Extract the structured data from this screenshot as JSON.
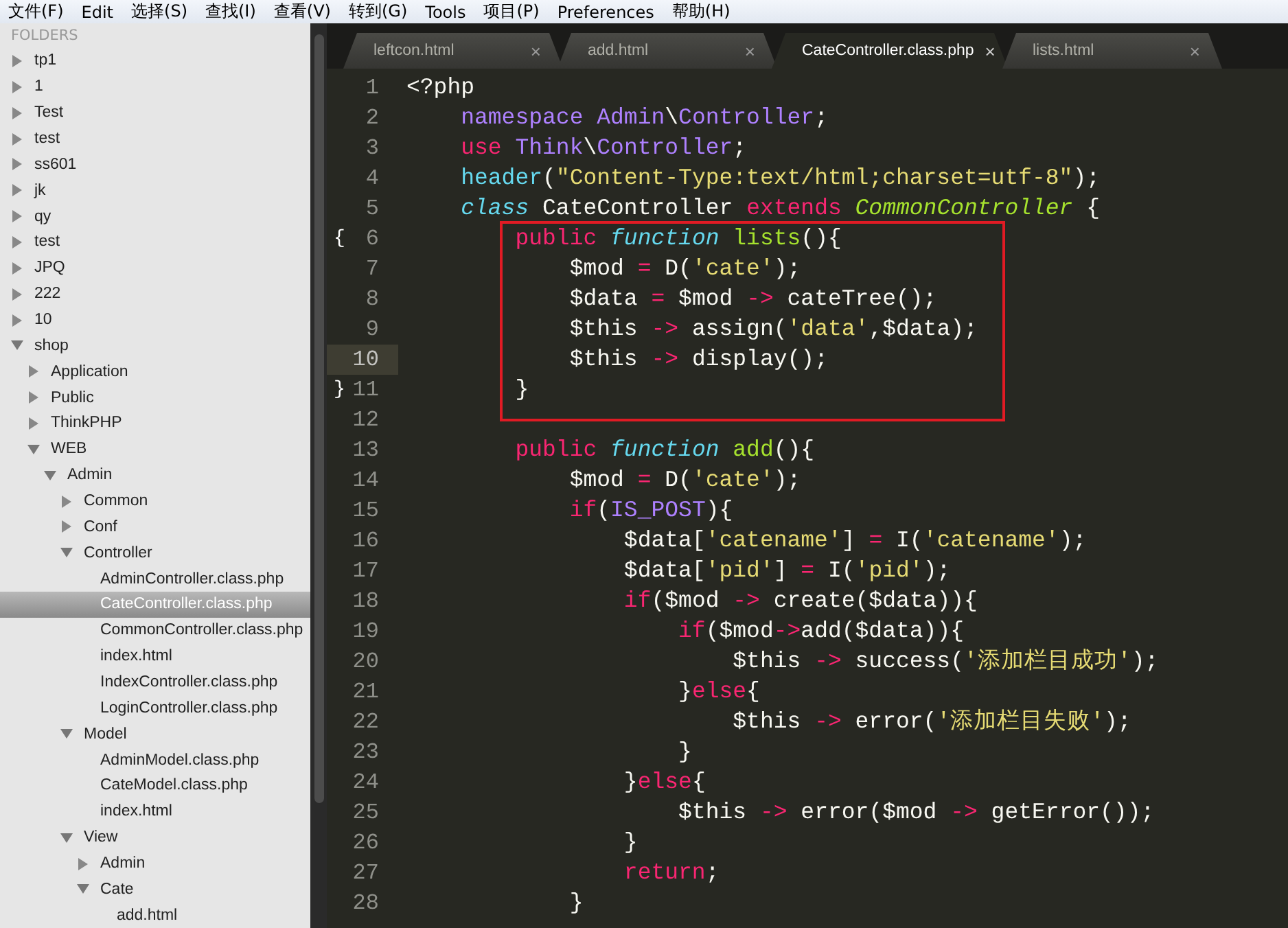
{
  "menu": [
    "文件(F)",
    "Edit",
    "选择(S)",
    "查找(I)",
    "查看(V)",
    "转到(G)",
    "Tools",
    "项目(P)",
    "Preferences",
    "帮助(H)"
  ],
  "sidebar": {
    "title": "FOLDERS",
    "items": [
      {
        "label": "tp1",
        "kind": "folder",
        "expanded": false,
        "selected": false
      },
      {
        "label": "1",
        "kind": "folder",
        "expanded": false,
        "selected": false
      },
      {
        "label": "Test",
        "kind": "folder",
        "expanded": false,
        "selected": false
      },
      {
        "label": "test",
        "kind": "folder",
        "expanded": false,
        "selected": false
      },
      {
        "label": "ss601",
        "kind": "folder",
        "expanded": false,
        "selected": false
      },
      {
        "label": "jk",
        "kind": "folder",
        "expanded": false,
        "selected": false
      },
      {
        "label": "qy",
        "kind": "folder",
        "expanded": false,
        "selected": false
      },
      {
        "label": "test",
        "kind": "folder",
        "expanded": false,
        "selected": false
      },
      {
        "label": "JPQ",
        "kind": "folder",
        "expanded": false,
        "selected": false
      },
      {
        "label": "222",
        "kind": "folder",
        "expanded": false,
        "selected": false
      },
      {
        "label": "10",
        "kind": "folder",
        "expanded": false,
        "selected": false
      },
      {
        "label": "shop",
        "kind": "folder",
        "expanded": true,
        "selected": false,
        "children": [
          {
            "label": "Application",
            "kind": "folder",
            "expanded": false,
            "selected": false
          },
          {
            "label": "Public",
            "kind": "folder",
            "expanded": false,
            "selected": false
          },
          {
            "label": "ThinkPHP",
            "kind": "folder",
            "expanded": false,
            "selected": false
          },
          {
            "label": "WEB",
            "kind": "folder",
            "expanded": true,
            "selected": false,
            "children": [
              {
                "label": "Admin",
                "kind": "folder",
                "expanded": true,
                "selected": false,
                "children": [
                  {
                    "label": "Common",
                    "kind": "folder",
                    "expanded": false,
                    "selected": false
                  },
                  {
                    "label": "Conf",
                    "kind": "folder",
                    "expanded": false,
                    "selected": false
                  },
                  {
                    "label": "Controller",
                    "kind": "folder",
                    "expanded": true,
                    "selected": false,
                    "children": [
                      {
                        "label": "AdminController.class.php",
                        "kind": "file",
                        "selected": false
                      },
                      {
                        "label": "CateController.class.php",
                        "kind": "file",
                        "selected": true
                      },
                      {
                        "label": "CommonController.class.php",
                        "kind": "file",
                        "selected": false
                      },
                      {
                        "label": "index.html",
                        "kind": "file",
                        "selected": false
                      },
                      {
                        "label": "IndexController.class.php",
                        "kind": "file",
                        "selected": false
                      },
                      {
                        "label": "LoginController.class.php",
                        "kind": "file",
                        "selected": false
                      }
                    ]
                  },
                  {
                    "label": "Model",
                    "kind": "folder",
                    "expanded": true,
                    "selected": false,
                    "children": [
                      {
                        "label": "AdminModel.class.php",
                        "kind": "file",
                        "selected": false
                      },
                      {
                        "label": "CateModel.class.php",
                        "kind": "file",
                        "selected": false
                      },
                      {
                        "label": "index.html",
                        "kind": "file",
                        "selected": false
                      }
                    ]
                  },
                  {
                    "label": "View",
                    "kind": "folder",
                    "expanded": true,
                    "selected": false,
                    "children": [
                      {
                        "label": "Admin",
                        "kind": "folder",
                        "expanded": false,
                        "selected": false
                      },
                      {
                        "label": "Cate",
                        "kind": "folder",
                        "expanded": true,
                        "selected": false,
                        "children": [
                          {
                            "label": "add.html",
                            "kind": "file",
                            "selected": false
                          }
                        ]
                      }
                    ]
                  }
                ]
              }
            ]
          }
        ]
      }
    ]
  },
  "tabs": [
    {
      "label": "leftcon.html",
      "close": "×",
      "selected": false
    },
    {
      "label": "add.html",
      "close": "×",
      "selected": false
    },
    {
      "label": "CateController.class.php",
      "close": "×",
      "selected": true
    },
    {
      "label": "lists.html",
      "close": "×",
      "selected": false
    }
  ],
  "code": [
    {
      "boxed": false,
      "lines": [
        {
          "number": "1",
          "current": false,
          "tokens": [
            {
              "kind": "text",
              "text": "<?php"
            }
          ]
        },
        {
          "number": "2",
          "current": false,
          "tokens": [
            {
              "kind": "constant",
              "text": "    namespace Admin"
            },
            {
              "kind": "text",
              "text": "\\"
            },
            {
              "kind": "constant",
              "text": "Controller"
            },
            {
              "kind": "text",
              "text": ";"
            }
          ]
        },
        {
          "number": "3",
          "current": false,
          "tokens": [
            {
              "kind": "keyword",
              "text": "    use "
            },
            {
              "kind": "constant",
              "text": "Think"
            },
            {
              "kind": "text",
              "text": "\\"
            },
            {
              "kind": "constant",
              "text": "Controller"
            },
            {
              "kind": "text",
              "text": ";"
            }
          ]
        },
        {
          "number": "4",
          "current": false,
          "tokens": [
            {
              "kind": "support",
              "text": "    header"
            },
            {
              "kind": "text",
              "text": "("
            },
            {
              "kind": "string",
              "text": "\"Content-Type:text/html;charset=utf-8\""
            },
            {
              "kind": "text",
              "text": ");"
            }
          ]
        },
        {
          "number": "5",
          "current": false,
          "tokens": [
            {
              "kind": "storage",
              "text": "    class"
            },
            {
              "kind": "text",
              "text": " CateController "
            },
            {
              "kind": "keyword",
              "text": "extends "
            },
            {
              "kind": "inherit",
              "text": "CommonController"
            },
            {
              "kind": "text",
              "text": " {"
            }
          ]
        }
      ]
    },
    {
      "boxed": true,
      "lines": [
        {
          "number": "6",
          "fold": "{",
          "current": false,
          "tokens": [
            {
              "kind": "keyword",
              "text": "        public "
            },
            {
              "kind": "storage",
              "text": "function "
            },
            {
              "kind": "entity",
              "text": "lists"
            },
            {
              "kind": "text",
              "text": "(){"
            }
          ]
        },
        {
          "number": "7",
          "current": false,
          "tokens": [
            {
              "kind": "text",
              "text": "            $mod "
            },
            {
              "kind": "operator",
              "text": "="
            },
            {
              "kind": "text",
              "text": " D("
            },
            {
              "kind": "string",
              "text": "'cate'"
            },
            {
              "kind": "text",
              "text": ");"
            }
          ]
        },
        {
          "number": "8",
          "current": false,
          "tokens": [
            {
              "kind": "text",
              "text": "            $data "
            },
            {
              "kind": "operator",
              "text": "="
            },
            {
              "kind": "text",
              "text": " $mod "
            },
            {
              "kind": "operator",
              "text": "->"
            },
            {
              "kind": "text",
              "text": " cateTree();"
            }
          ]
        },
        {
          "number": "9",
          "current": false,
          "tokens": [
            {
              "kind": "text",
              "text": "            $this "
            },
            {
              "kind": "operator",
              "text": "->"
            },
            {
              "kind": "text",
              "text": " assign("
            },
            {
              "kind": "string",
              "text": "'data'"
            },
            {
              "kind": "text",
              "text": ",$data);"
            }
          ]
        },
        {
          "number": "10",
          "current": true,
          "tokens": [
            {
              "kind": "text",
              "text": "            $this "
            },
            {
              "kind": "operator",
              "text": "->"
            },
            {
              "kind": "text",
              "text": " display();"
            }
          ]
        },
        {
          "number": "11",
          "fold": "}",
          "current": false,
          "tokens": [
            {
              "kind": "text",
              "text": "        }"
            }
          ]
        }
      ]
    },
    {
      "boxed": false,
      "lines": [
        {
          "number": "12",
          "current": false
        },
        {
          "number": "13",
          "current": false,
          "tokens": [
            {
              "kind": "keyword",
              "text": "        public "
            },
            {
              "kind": "storage",
              "text": "function "
            },
            {
              "kind": "entity",
              "text": "add"
            },
            {
              "kind": "text",
              "text": "(){"
            }
          ]
        },
        {
          "number": "14",
          "current": false,
          "tokens": [
            {
              "kind": "text",
              "text": "            $mod "
            },
            {
              "kind": "operator",
              "text": "="
            },
            {
              "kind": "text",
              "text": " D("
            },
            {
              "kind": "string",
              "text": "'cate'"
            },
            {
              "kind": "text",
              "text": ");"
            }
          ]
        },
        {
          "number": "15",
          "current": false,
          "tokens": [
            {
              "kind": "keyword",
              "text": "            if"
            },
            {
              "kind": "text",
              "text": "("
            },
            {
              "kind": "constant",
              "text": "IS_POST"
            },
            {
              "kind": "text",
              "text": "){"
            }
          ]
        },
        {
          "number": "16",
          "current": false,
          "tokens": [
            {
              "kind": "text",
              "text": "                $data["
            },
            {
              "kind": "string",
              "text": "'catename'"
            },
            {
              "kind": "text",
              "text": "] "
            },
            {
              "kind": "operator",
              "text": "="
            },
            {
              "kind": "text",
              "text": " I("
            },
            {
              "kind": "string",
              "text": "'catename'"
            },
            {
              "kind": "text",
              "text": ");"
            }
          ]
        },
        {
          "number": "17",
          "current": false,
          "tokens": [
            {
              "kind": "text",
              "text": "                $data["
            },
            {
              "kind": "string",
              "text": "'pid'"
            },
            {
              "kind": "text",
              "text": "] "
            },
            {
              "kind": "operator",
              "text": "="
            },
            {
              "kind": "text",
              "text": " I("
            },
            {
              "kind": "string",
              "text": "'pid'"
            },
            {
              "kind": "text",
              "text": ");"
            }
          ]
        },
        {
          "number": "18",
          "current": false,
          "tokens": [
            {
              "kind": "keyword",
              "text": "                if"
            },
            {
              "kind": "text",
              "text": "($mod "
            },
            {
              "kind": "operator",
              "text": "->"
            },
            {
              "kind": "text",
              "text": " create($data)){"
            }
          ]
        },
        {
          "number": "19",
          "current": false,
          "tokens": [
            {
              "kind": "keyword",
              "text": "                    if"
            },
            {
              "kind": "text",
              "text": "($mod"
            },
            {
              "kind": "operator",
              "text": "->"
            },
            {
              "kind": "text",
              "text": "add($data)){"
            }
          ]
        },
        {
          "number": "20",
          "current": false,
          "tokens": [
            {
              "kind": "text",
              "text": "                        $this "
            },
            {
              "kind": "operator",
              "text": "->"
            },
            {
              "kind": "text",
              "text": " success("
            },
            {
              "kind": "string",
              "text": "'添加栏目成功'"
            },
            {
              "kind": "text",
              "text": ");"
            }
          ]
        },
        {
          "number": "21",
          "current": false,
          "tokens": [
            {
              "kind": "text",
              "text": "                    }"
            },
            {
              "kind": "keyword",
              "text": "else"
            },
            {
              "kind": "text",
              "text": "{"
            }
          ]
        },
        {
          "number": "22",
          "current": false,
          "tokens": [
            {
              "kind": "text",
              "text": "                        $this "
            },
            {
              "kind": "operator",
              "text": "->"
            },
            {
              "kind": "text",
              "text": " error("
            },
            {
              "kind": "string",
              "text": "'添加栏目失败'"
            },
            {
              "kind": "text",
              "text": ");"
            }
          ]
        },
        {
          "number": "23",
          "current": false,
          "tokens": [
            {
              "kind": "text",
              "text": "                    }"
            }
          ]
        },
        {
          "number": "24",
          "current": false,
          "tokens": [
            {
              "kind": "text",
              "text": "                }"
            },
            {
              "kind": "keyword",
              "text": "else"
            },
            {
              "kind": "text",
              "text": "{"
            }
          ]
        },
        {
          "number": "25",
          "current": false,
          "tokens": [
            {
              "kind": "text",
              "text": "                    $this "
            },
            {
              "kind": "operator",
              "text": "->"
            },
            {
              "kind": "text",
              "text": " error($mod "
            },
            {
              "kind": "operator",
              "text": "->"
            },
            {
              "kind": "text",
              "text": " getError());"
            }
          ]
        },
        {
          "number": "26",
          "current": false,
          "tokens": [
            {
              "kind": "text",
              "text": "                }"
            }
          ]
        },
        {
          "number": "27",
          "current": false,
          "tokens": [
            {
              "kind": "keyword",
              "text": "                return"
            },
            {
              "kind": "text",
              "text": ";"
            }
          ]
        },
        {
          "number": "28",
          "current": false,
          "tokens": [
            {
              "kind": "text",
              "text": "            }"
            }
          ]
        }
      ]
    }
  ]
}
